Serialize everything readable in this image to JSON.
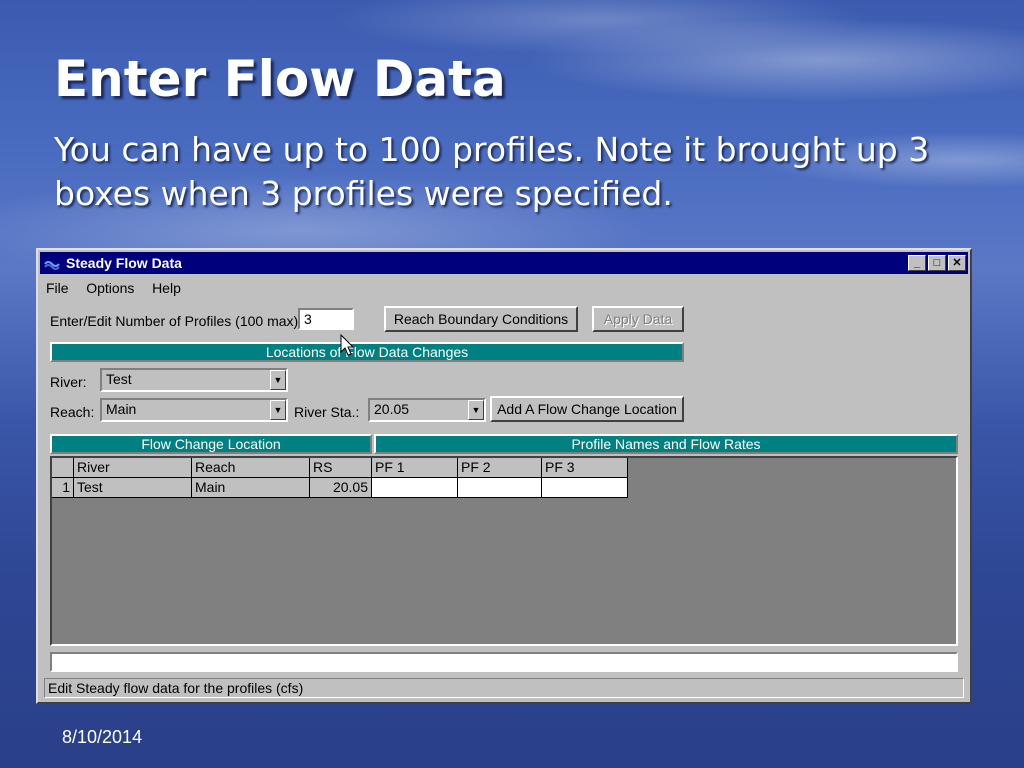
{
  "slide": {
    "title": "Enter Flow Data",
    "body": "You can have up to 100 profiles.  Note it brought up 3 boxes when 3 profiles were specified.",
    "date": "8/10/2014"
  },
  "window": {
    "title": "Steady Flow Data",
    "app_icon": "hec-ras-icon",
    "controls": {
      "minimize": "_",
      "maximize": "□",
      "close": "✕"
    },
    "menu": {
      "file": "File",
      "options": "Options",
      "help": "Help"
    },
    "profiles": {
      "label": "Enter/Edit Number of Profiles (100 max):",
      "value": "3"
    },
    "buttons": {
      "reach_boundary": "Reach Boundary Conditions",
      "apply_data": "Apply Data",
      "add_flow_change": "Add A Flow Change Location"
    },
    "locations_header": "Locations of Flow Data Changes",
    "river": {
      "label": "River:",
      "value": "Test"
    },
    "reach": {
      "label": "Reach:",
      "value": "Main"
    },
    "river_sta": {
      "label": "River Sta.:",
      "value": "20.05"
    },
    "grid": {
      "group_left": "Flow Change Location",
      "group_right": "Profile Names and Flow Rates",
      "columns": [
        "River",
        "Reach",
        "RS",
        "PF 1",
        "PF 2",
        "PF 3"
      ],
      "rows": [
        {
          "num": "1",
          "river": "Test",
          "reach": "Main",
          "rs": "20.05",
          "pf1": "",
          "pf2": "",
          "pf3": ""
        }
      ]
    },
    "message": "",
    "status": "Edit Steady flow data for the profiles (cfs)"
  }
}
